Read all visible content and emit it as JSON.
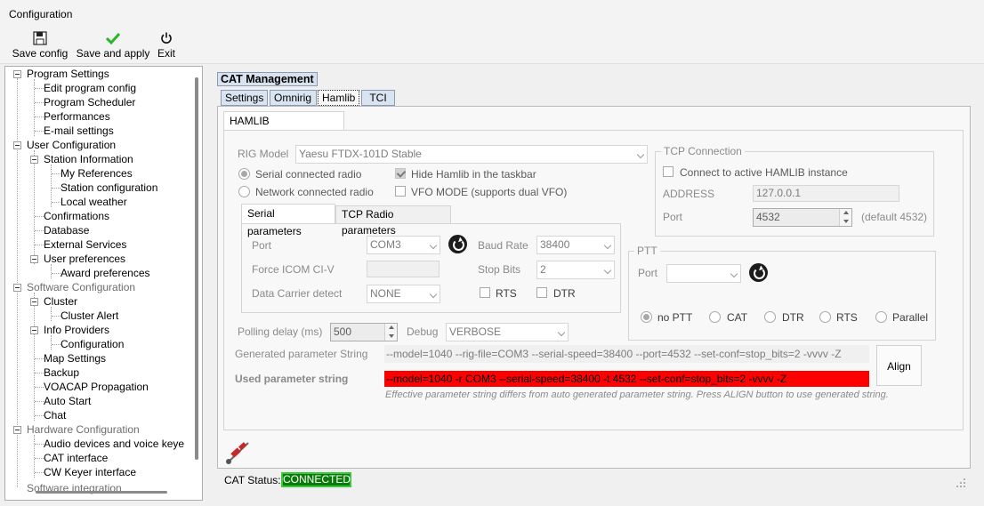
{
  "window": {
    "title": "Configuration"
  },
  "toolbar": {
    "save_config": "Save config",
    "save_apply": "Save and apply",
    "exit": "Exit"
  },
  "tree": [
    "Program Settings",
    "Edit program config",
    "Program Scheduler",
    "Performances",
    "E-mail settings",
    "User Configuration",
    "Station Information",
    "My References",
    "Station configuration",
    "Local weather",
    "Confirmations",
    "Database",
    "External Services",
    "User preferences",
    "Award preferences",
    "Software Configuration",
    "Cluster",
    "Cluster Alert",
    "Info Providers",
    "Configuration",
    "Map Settings",
    "Backup",
    "VOACAP Propagation",
    "Auto Start",
    "Chat",
    "Hardware Configuration",
    "Audio devices and voice keye",
    "CAT interface",
    "CW Keyer interface",
    "Software integration"
  ],
  "panel": {
    "title": "CAT Management",
    "tabs": [
      "Settings",
      "Omnirig",
      "Hamlib",
      "TCI"
    ],
    "subtab": "HAMLIB PARAMETERS"
  },
  "hamlib": {
    "rig_model_label": "RIG Model",
    "rig_model": "Yaesu FTDX-101D Stable",
    "serial_radio": "Serial connected radio",
    "network_radio": "Network connected radio",
    "hide_hamlib": "Hide Hamlib in the taskbar",
    "vfo_mode": "VFO MODE (supports dual VFO)",
    "serial_tab": "Serial parameters",
    "tcp_tab": "TCP Radio parameters",
    "port_label": "Port",
    "port": "COM3",
    "baud_label": "Baud Rate",
    "baud": "38400",
    "force_icom_label": "Force ICOM CI-V",
    "stop_bits_label": "Stop Bits",
    "stop_bits": "2",
    "dcd_label": "Data Carrier detect",
    "dcd": "NONE",
    "rts": "RTS",
    "dtr": "DTR",
    "polling_label": "Polling delay (ms)",
    "polling": "500",
    "debug_label": "Debug",
    "debug": "VERBOSE",
    "gen_label": "Generated parameter String",
    "gen_string": "--model=1040 --rig-file=COM3 --serial-speed=38400 --port=4532 --set-conf=stop_bits=2 -vvvv -Z",
    "used_label": "Used parameter string",
    "used_string": "--model=1040 -r COM3 --serial-speed=38400 -t 4532 --set-conf=stop_bits=2 -vvvv -Z",
    "align": "Align",
    "warning": "Effective parameter string differs from auto generated parameter string. Press ALIGN button to use generated string."
  },
  "tcp": {
    "title": "TCP Connection",
    "connect": "Connect to active HAMLIB instance",
    "address_label": "ADDRESS",
    "address": "127.0.0.1",
    "port_label": "Port",
    "port": "4532",
    "default": "(default 4532)"
  },
  "ptt": {
    "title": "PTT",
    "port_label": "Port",
    "options": [
      "no PTT",
      "CAT",
      "DTR",
      "RTS",
      "Parallel"
    ]
  },
  "status": {
    "label": "CAT Status:",
    "value": "CONNECTED"
  },
  "colors": {
    "connected_bg": "#0a7a0a",
    "used_string_bg": "#ff0000",
    "tab_bg": "#d9e4f1"
  }
}
